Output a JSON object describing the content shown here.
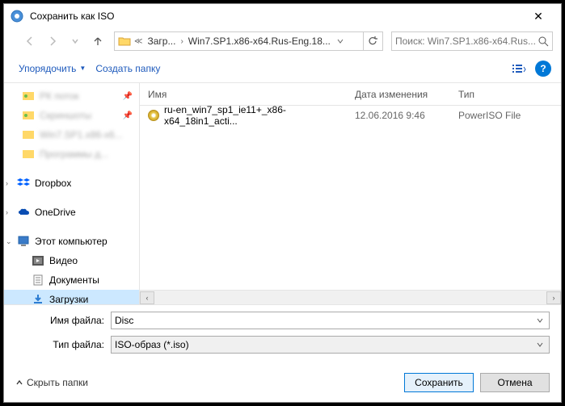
{
  "title": "Сохранить как ISO",
  "breadcrumb": {
    "parent": "Загр...",
    "current": "Win7.SP1.x86-x64.Rus-Eng.18..."
  },
  "search": {
    "placeholder": "Поиск: Win7.SP1.x86-x64.Rus..."
  },
  "toolbar": {
    "organize": "Упорядочить",
    "newfolder": "Создать папку"
  },
  "sidebar": {
    "pinned": [
      {
        "label": "РК поток"
      },
      {
        "label": "Скриншоты"
      },
      {
        "label": "Win7.SP1.x86-x6..."
      },
      {
        "label": "Программы д..."
      }
    ],
    "cloud": [
      {
        "label": "Dropbox"
      },
      {
        "label": "OneDrive"
      }
    ],
    "pc": "Этот компьютер",
    "pc_items": [
      {
        "label": "Видео"
      },
      {
        "label": "Документы"
      },
      {
        "label": "Загрузки",
        "selected": true
      }
    ]
  },
  "columns": {
    "name": "Имя",
    "date": "Дата изменения",
    "type": "Тип"
  },
  "files": [
    {
      "name": "ru-en_win7_sp1_ie11+_x86-x64_18in1_acti...",
      "date": "12.06.2016 9:46",
      "type": "PowerISO File"
    }
  ],
  "form": {
    "filename_label": "Имя файла:",
    "filename_value": "Disc",
    "filetype_label": "Тип файла:",
    "filetype_value": "ISO-образ (*.iso)"
  },
  "footer": {
    "hide_folders": "Скрыть папки",
    "save": "Сохранить",
    "cancel": "Отмена"
  }
}
